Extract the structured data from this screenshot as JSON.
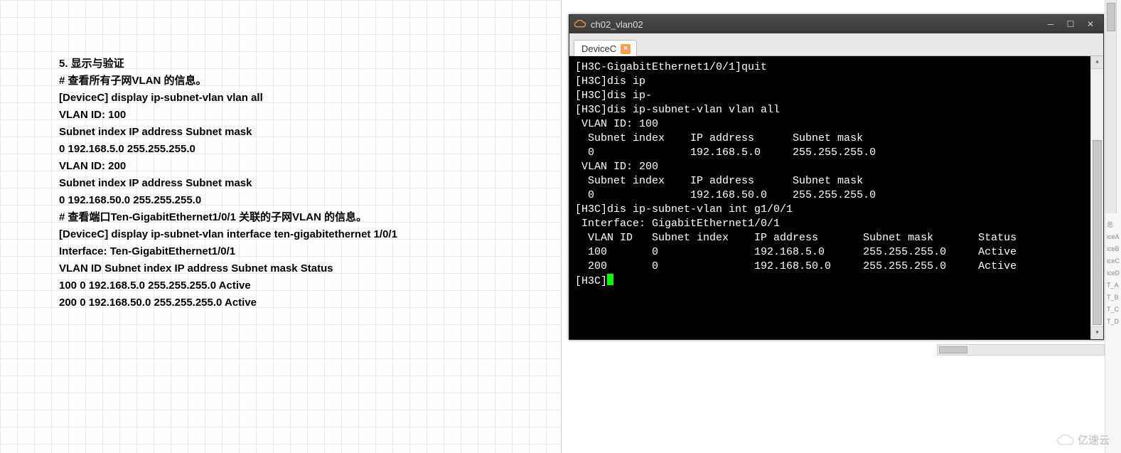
{
  "doc": {
    "lines": [
      "5. 显示与验证",
      "# 查看所有子网VLAN 的信息。",
      "[DeviceC] display ip-subnet-vlan vlan all",
      "VLAN ID: 100",
      "Subnet index IP address Subnet mask",
      "0 192.168.5.0 255.255.255.0",
      "VLAN ID: 200",
      "Subnet index IP address Subnet mask",
      "0 192.168.50.0 255.255.255.0",
      "# 查看端口Ten-GigabitEthernet1/0/1 关联的子网VLAN 的信息。",
      "[DeviceC] display ip-subnet-vlan interface ten-gigabitethernet 1/0/1",
      "Interface: Ten-GigabitEthernet1/0/1",
      "VLAN ID Subnet index IP address Subnet mask Status",
      "100 0 192.168.5.0 255.255.255.0 Active",
      "200 0 192.168.50.0 255.255.255.0 Active"
    ]
  },
  "terminal": {
    "window_title": "ch02_vlan02",
    "tab_label": "DeviceC",
    "lines": [
      "[H3C-GigabitEthernet1/0/1]quit",
      "[H3C]dis ip",
      "[H3C]dis ip-",
      "[H3C]dis ip-subnet-vlan vlan all",
      " VLAN ID: 100",
      "  Subnet index    IP address      Subnet mask",
      "  0               192.168.5.0     255.255.255.0",
      "",
      " VLAN ID: 200",
      "  Subnet index    IP address      Subnet mask",
      "  0               192.168.50.0    255.255.255.0",
      "",
      "[H3C]dis ip-subnet-vlan int g1/0/1",
      " Interface: GigabitEthernet1/0/1",
      "  VLAN ID   Subnet index    IP address       Subnet mask       Status",
      "",
      "  100       0               192.168.5.0      255.255.255.0     Active",
      "  200       0               192.168.50.0     255.255.255.0     Active",
      ""
    ],
    "prompt": "[H3C]"
  },
  "right_panel": {
    "labels": [
      "总",
      "iceA",
      "iceB",
      "iceC",
      "iceD",
      "T_A",
      "T_B",
      "T_C",
      "T_D"
    ]
  },
  "watermark": {
    "text": "亿速云"
  }
}
